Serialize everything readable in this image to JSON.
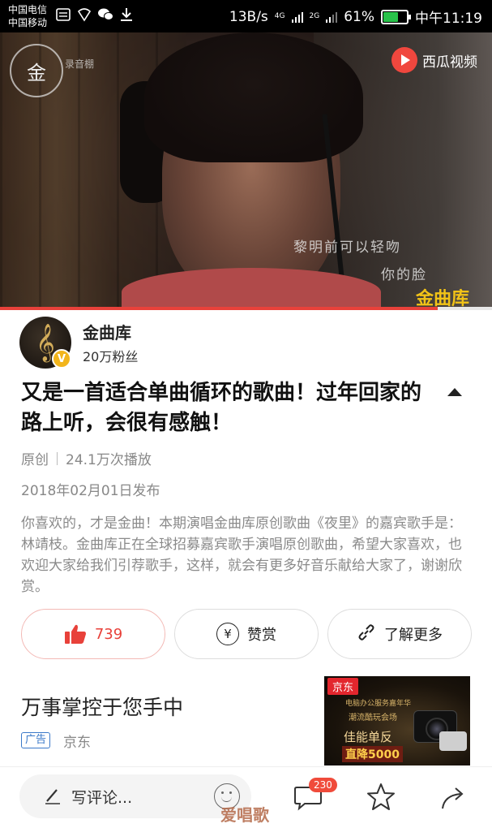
{
  "status_bar": {
    "carrier_1": "中国电信",
    "carrier_2": "中国移动",
    "speed": "13B/s",
    "net_1": "4G",
    "net_2": "2G",
    "battery": "61%",
    "battery_level": 0.61,
    "time": "中午11:19"
  },
  "video": {
    "channel_logo": "金",
    "channel_logo_sub": "录音棚",
    "platform": "西瓜视频",
    "lyric_line_1": "黎明前可以轻吻",
    "lyric_line_2": "你的脸",
    "watermark": "金曲库",
    "progress": 0.89,
    "colors": {
      "progress_played": "#e8413a",
      "watermark": "#f2c317"
    }
  },
  "author": {
    "name": "金曲库",
    "fans": "20万粉丝",
    "verified_badge": "V",
    "avatar_glyph": "𝄞"
  },
  "article": {
    "title": "又是一首适合单曲循环的歌曲！过年回家的路上听，会很有感触！",
    "type": "原创",
    "plays": "24.1万次播放",
    "date": "2018年02月01日发布",
    "description": "你喜欢的，才是金曲！本期演唱金曲库原创歌曲《夜里》的嘉宾歌手是：林靖枝。金曲库正在全球招募嘉宾歌手演唱原创歌曲，希望大家喜欢，也欢迎大家给我们引荐歌手，这样，就会有更多好音乐献给大家了，谢谢欣赏。"
  },
  "actions": {
    "like_count": "739",
    "reward_label": "赞赏",
    "reward_icon": "¥",
    "more_label": "了解更多"
  },
  "ad": {
    "title": "万事掌控于您手中",
    "tag": "广告",
    "source": "京东",
    "image_brand": "京东",
    "image_line_1": "电脑办公服务嘉年华",
    "image_line_2": "潮流酷玩会场",
    "image_line_3": "佳能单反",
    "image_line_4": "直降5000"
  },
  "bottom_bar": {
    "comment_placeholder": "写评论...",
    "comment_count": "230",
    "watermark": "爱唱歌"
  },
  "icons": [
    "wifi-icon",
    "wechat-icon",
    "download-icon",
    "shield-icon",
    "thumb-up-icon",
    "yen-icon",
    "link-icon",
    "pen-icon",
    "emoji-icon",
    "comment-icon",
    "star-icon",
    "share-icon",
    "collapse-arrow-icon",
    "play-icon"
  ]
}
